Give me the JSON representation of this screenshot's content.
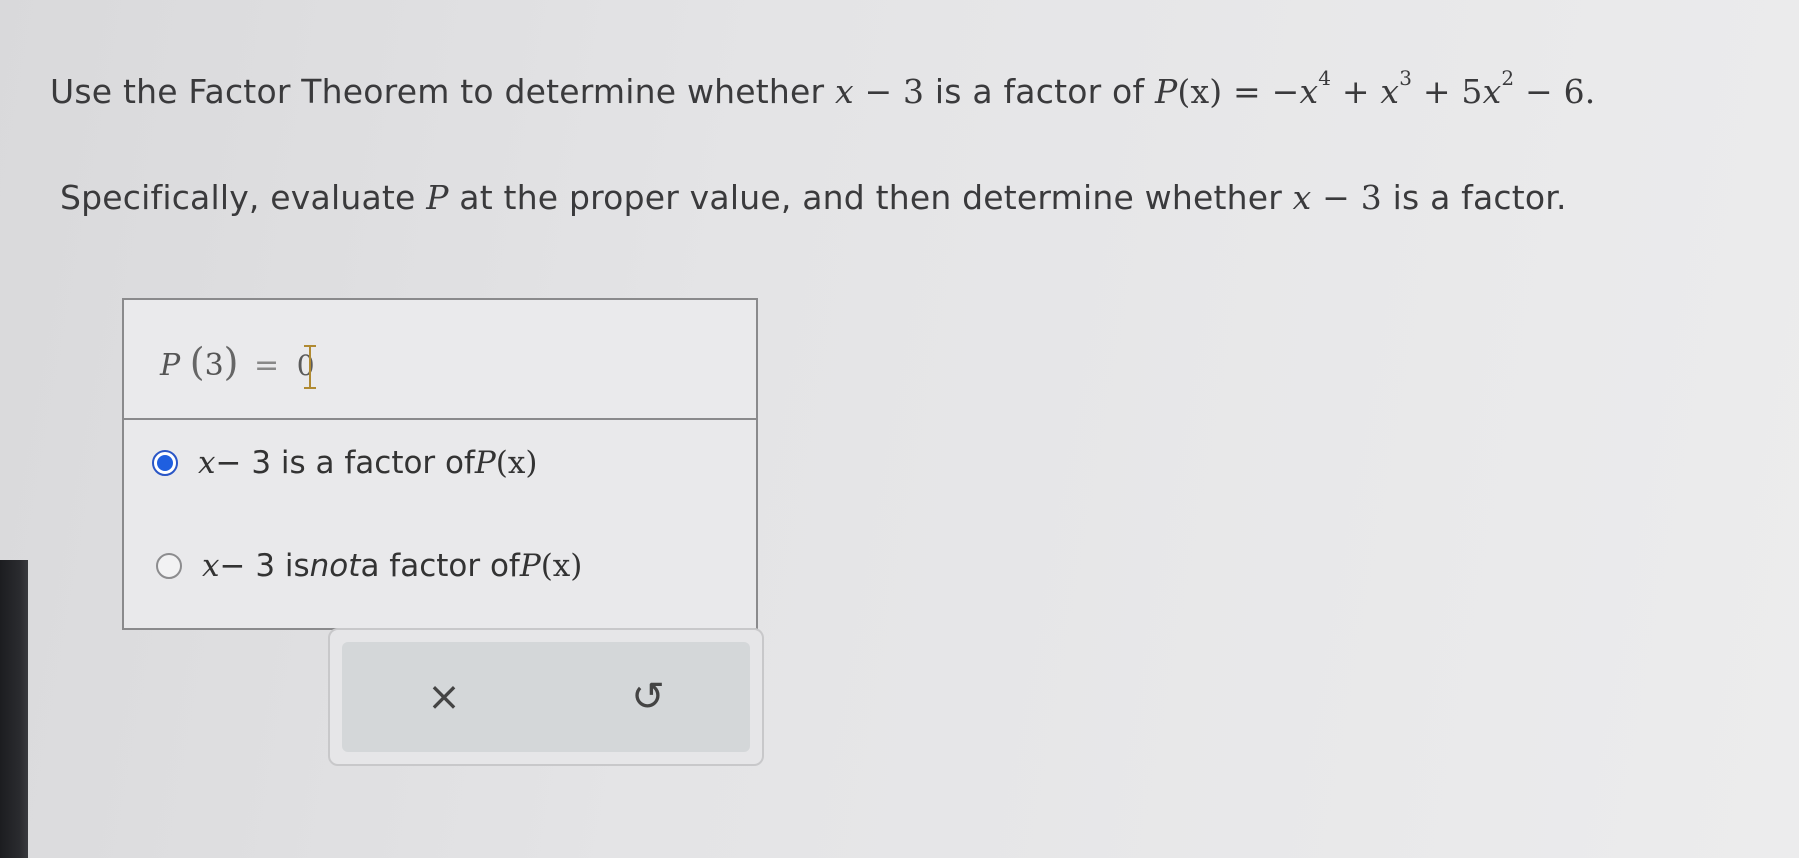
{
  "question": {
    "line1_prefix": "Use the Factor Theorem to determine whether ",
    "factor_var": "x",
    "factor_rest": " − 3",
    "line1_mid": " is a factor of ",
    "poly_P": "P",
    "poly_arg": "(x)",
    "poly_eq": " = −",
    "exp4": "4",
    "exp3": "3",
    "exp2": "2",
    "poly_plus_x": " + ",
    "poly_plus5": " + 5",
    "poly_tail": " − 6.",
    "line2_prefix": "Specifically, evaluate ",
    "line2_P": "P",
    "line2_mid": " at the proper value, and then determine whether ",
    "line2_suffix": " is a factor."
  },
  "answer": {
    "p_label": "P",
    "p_arg": "3",
    "equals": "=",
    "input_value": "0"
  },
  "options": [
    {
      "var": "x",
      "text_a": " − 3 is a factor of ",
      "emph": "",
      "text_b": "",
      "P": "P",
      "arg": "(x)",
      "selected": true
    },
    {
      "var": "x",
      "text_a": " − 3 is ",
      "emph": "not",
      "text_b": " a factor of ",
      "P": "P",
      "arg": "(x)",
      "selected": false
    }
  ],
  "toolbar": {
    "clear_icon": "×",
    "undo_icon": "↺"
  }
}
